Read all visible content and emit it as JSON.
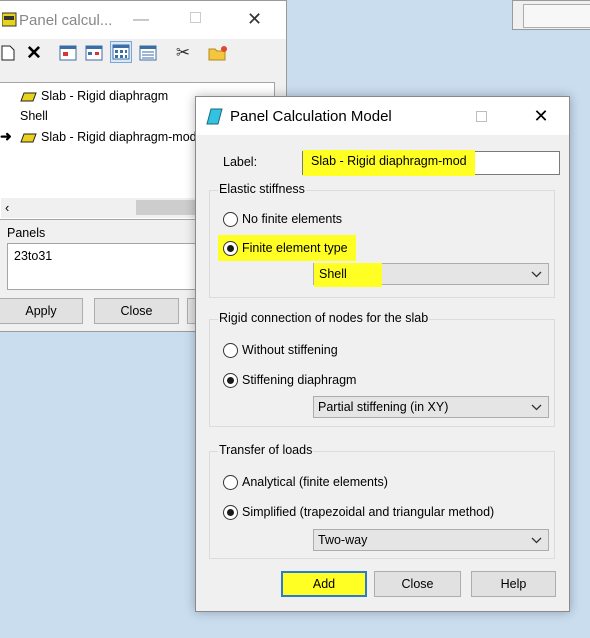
{
  "background_window": {
    "title": "Panel calcul...",
    "toolbar_icons": [
      "new-icon",
      "delete-icon",
      "view-1-icon",
      "view-2-icon",
      "grid-view-icon",
      "table-view-icon",
      "cut-icon",
      "folder-open-icon"
    ],
    "models": [
      {
        "label": "Slab - Rigid diaphragm",
        "active": false
      },
      {
        "label": "Shell",
        "active": false
      },
      {
        "label": "Slab - Rigid diaphragm-mod",
        "active": true
      }
    ],
    "panels_label": "Panels",
    "panels_value": "23to31",
    "apply_label": "Apply",
    "close_label": "Close"
  },
  "dialog": {
    "title": "Panel Calculation Model",
    "label_caption": "Label:",
    "label_value": "Slab - Rigid diaphragm-mod",
    "elastic": {
      "title": "Elastic stiffness",
      "option_none": "No finite elements",
      "option_fe": "Finite element type",
      "selected": "Finite element type",
      "fe_type_value": "Shell"
    },
    "rigid": {
      "title": "Rigid connection of nodes for the slab",
      "option_without": "Without stiffening",
      "option_diaphragm": "Stiffening diaphragm",
      "selected": "Stiffening diaphragm",
      "stiffening_value": "Partial stiffening (in XY)"
    },
    "loads": {
      "title": "Transfer of loads",
      "option_analytical": "Analytical (finite elements)",
      "option_simplified": "Simplified (trapezoidal and triangular method)",
      "selected": "Simplified (trapezoidal and triangular method)",
      "distribution_value": "Two-way"
    },
    "buttons": {
      "add": "Add",
      "close": "Close",
      "help": "Help"
    },
    "highlight_color": "#ffff24"
  }
}
